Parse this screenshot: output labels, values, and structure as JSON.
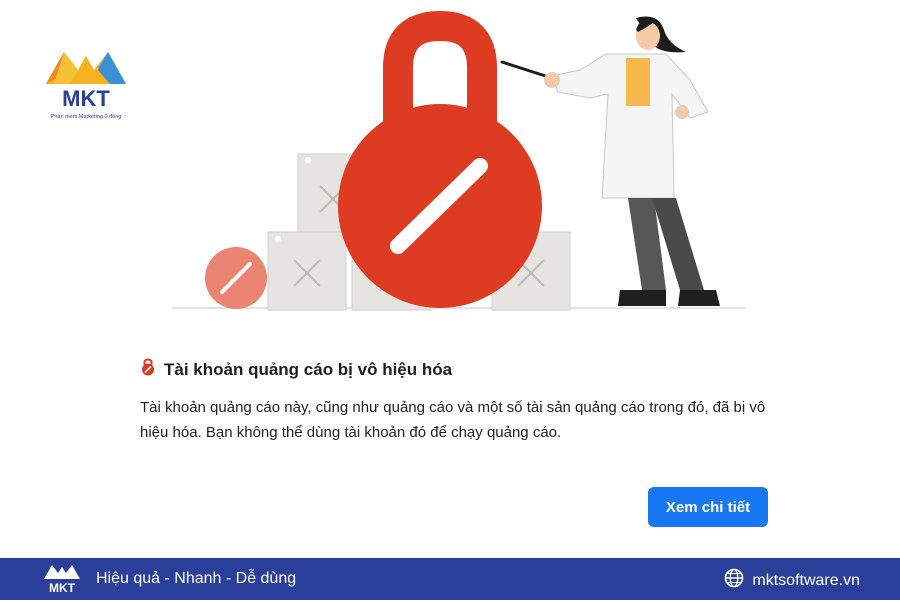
{
  "brand": {
    "name": "MKT",
    "tagline": "Phần mềm Marketing 0 đồng"
  },
  "notice": {
    "title": "Tài khoản quảng cáo bị vô hiệu hóa",
    "body": "Tài khoản quảng cáo này, cũng như quảng cáo và một số tài sản quảng cáo trong đó, đã bị vô hiệu hóa. Bạn không thể dùng tài khoản đó để chạy quảng cáo.",
    "icon": "lock-icon"
  },
  "actions": {
    "details_label": "Xem chi tiết"
  },
  "footer": {
    "slogan": "Hiệu quả - Nhanh - Dễ dùng",
    "website": "mktsoftware.vn",
    "website_icon": "globe-icon"
  },
  "colors": {
    "primary_button": "#1877f2",
    "footer_bg": "#2a3f9a",
    "lock_red": "#dd3b22"
  }
}
